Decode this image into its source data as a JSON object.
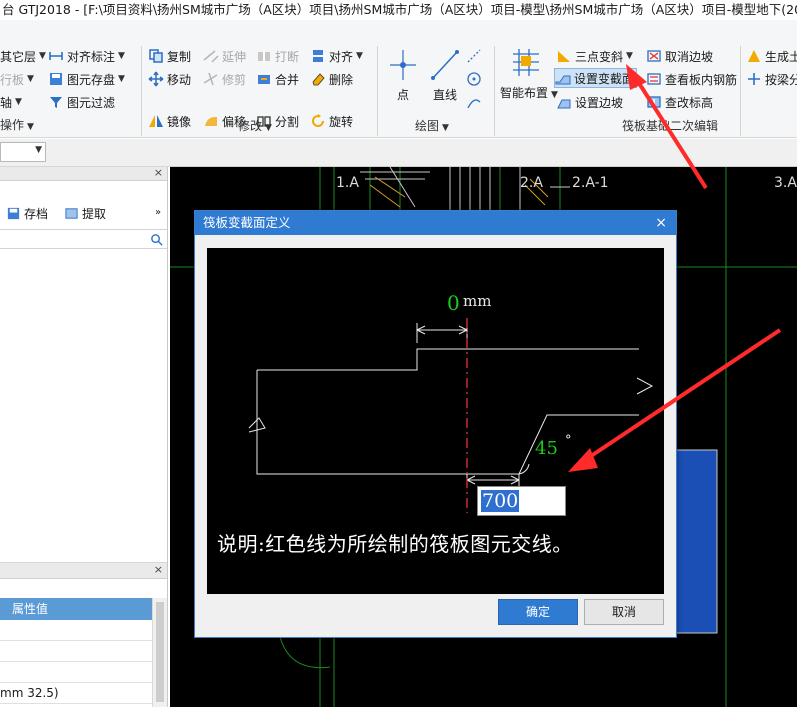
{
  "window": {
    "title": "台 GTJ2018 - [F:\\项目资料\\扬州SM城市广场（A区块）项目\\扬州SM城市广场（A区块）项目-模型\\扬州SM城市广场（A区块）项目-模型地下(2018浙"
  },
  "ribbon": {
    "left_col": [
      "其它层",
      "行板",
      "轴",
      "操作"
    ],
    "col1": {
      "align_mark": "对齐标注",
      "save_element": "图元存盘",
      "filter_element": "图元过滤"
    },
    "modify": {
      "copy": "复制",
      "extend": "延伸",
      "break": "打断",
      "align": "对齐",
      "move": "移动",
      "trim": "修剪",
      "merge": "合并",
      "delete": "删除",
      "mirror": "镜像",
      "offset": "偏移",
      "split": "分割",
      "rotate": "旋转",
      "group_label": "修改"
    },
    "draw": {
      "point": "点",
      "line": "直线",
      "group_label": "绘图"
    },
    "raft": {
      "smart_layout": "智能布置",
      "three_point_slope": "三点变斜",
      "set_variable_section": "设置变截面",
      "set_edge_slope": "设置边坡",
      "cancel_edge_slope": "取消边坡",
      "view_rebar": "查看板内钢筋",
      "check_elevation": "查改标高",
      "group_label": "筏板基础二次编辑"
    },
    "right": {
      "generate": "生成土",
      "by_beam": "按梁分"
    }
  },
  "left_panel": {
    "save_label": "存档",
    "extract_label": "提取",
    "property_value_header": "属性值",
    "property_row_text": "mm 32.5)"
  },
  "canvas": {
    "axis_labels": [
      "1.A",
      "2.A",
      "2.A-1",
      "3.A"
    ]
  },
  "dialog": {
    "title": "筏板变截面定义",
    "offset_value": "0",
    "offset_unit": "mm",
    "angle_value": "45",
    "angle_unit": "°",
    "width_input": "700",
    "note": "说明:红色线为所绘制的筏板图元交线。",
    "ok": "确定",
    "cancel": "取消"
  },
  "colors": {
    "accent": "#2f7bd2",
    "annotation_green": "#1ec81e",
    "annotation_red": "#ff2a2a",
    "selection_blue": "#1c4fb5"
  }
}
